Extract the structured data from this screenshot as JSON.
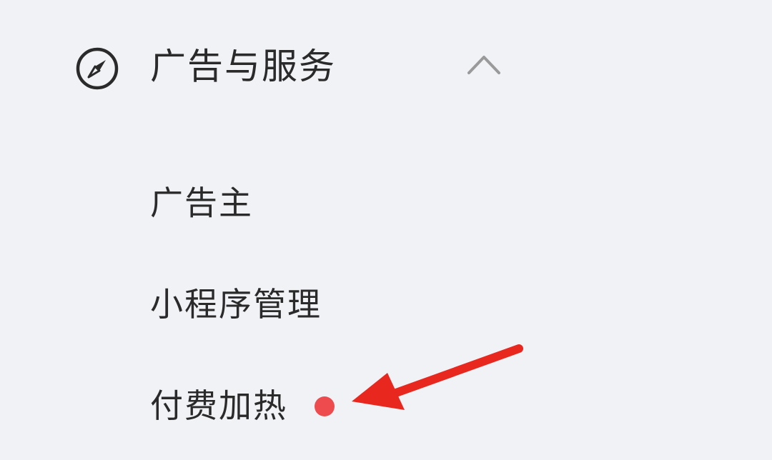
{
  "section": {
    "icon": "compass-icon",
    "title": "广告与服务",
    "expand_icon": "chevron-up-icon"
  },
  "items": [
    {
      "label": "广告主"
    },
    {
      "label": "小程序管理"
    },
    {
      "label": "付费加热",
      "badge": "red-dot"
    }
  ],
  "colors": {
    "background": "#f1f2f6",
    "text": "#2a2a2a",
    "badge": "#ee4b4f",
    "annotation_arrow": "#e8271f",
    "chevron": "#9a9a9a"
  }
}
